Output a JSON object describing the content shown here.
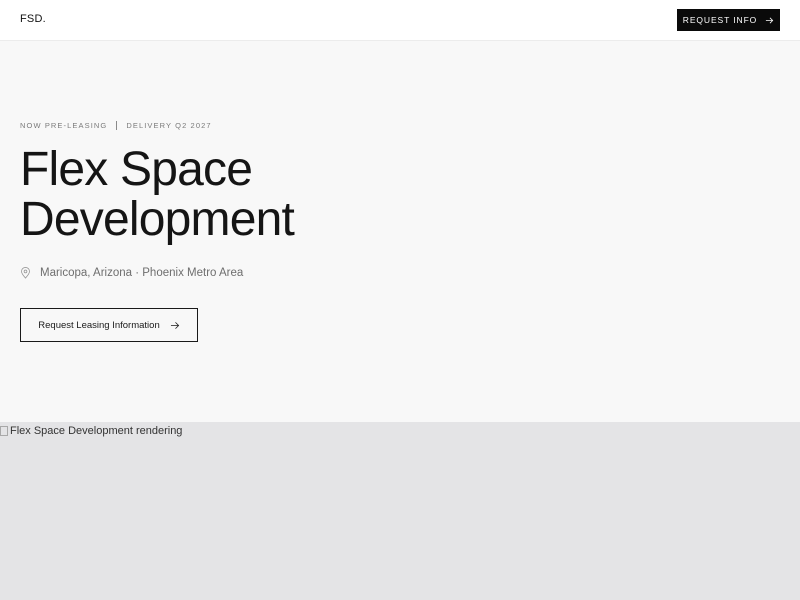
{
  "header": {
    "logo": "FSD.",
    "cta_label": "REQUEST INFO",
    "cta_icon": "arrow-right-icon"
  },
  "hero": {
    "eyebrow_left": "NOW PRE-LEASING",
    "eyebrow_right": "DELIVERY Q2 2027",
    "title_line1": "Flex Space",
    "title_line2": "Development",
    "location_icon": "map-pin-icon",
    "location": "Maricopa, Arizona · Phoenix Metro Area",
    "cta_label": "Request Leasing Information",
    "cta_icon": "arrow-right-icon"
  },
  "rendering": {
    "alt_text": "Flex Space Development rendering",
    "icon": "broken-image-icon"
  },
  "colors": {
    "accent": "#0a0a0a",
    "hero_bg": "#f8f8f8",
    "image_bg": "#e4e4e6",
    "muted_text": "#7a7a7a"
  }
}
